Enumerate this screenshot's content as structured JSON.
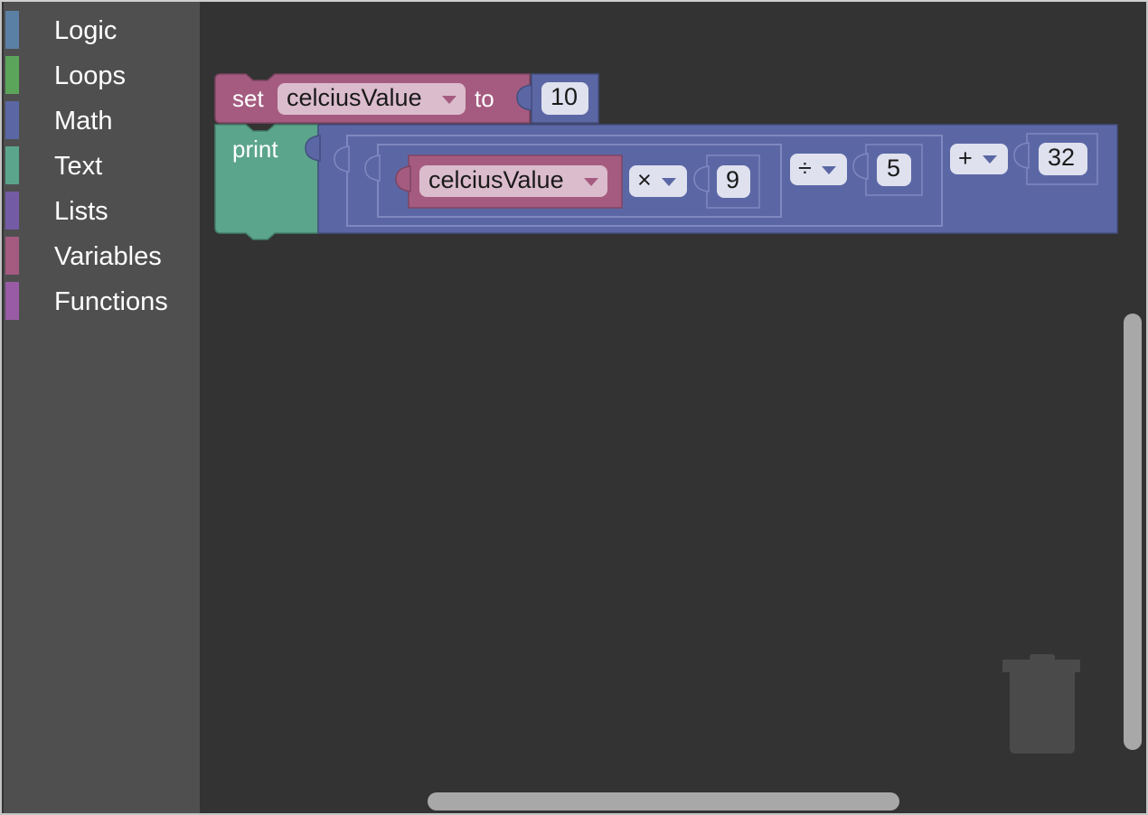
{
  "toolbox": {
    "categories": [
      {
        "label": "Logic",
        "color": "#5b80a5"
      },
      {
        "label": "Loops",
        "color": "#5ba55b"
      },
      {
        "label": "Math",
        "color": "#5b67a5"
      },
      {
        "label": "Text",
        "color": "#5ba58c"
      },
      {
        "label": "Lists",
        "color": "#745ba5"
      },
      {
        "label": "Variables",
        "color": "#a55b80"
      },
      {
        "label": "Functions",
        "color": "#995ba5"
      }
    ]
  },
  "workspace": {
    "set_block": {
      "keyword_set": "set",
      "variable": "celciusValue",
      "keyword_to": "to",
      "value": "10"
    },
    "print_block": {
      "keyword": "print",
      "variable": "celciusValue",
      "op_multiply": "×",
      "multiply_value": "9",
      "op_divide": "÷",
      "divide_value": "5",
      "op_add": "+",
      "add_value": "32"
    }
  },
  "icons": {
    "trash": "trash-icon",
    "dropdown": "chevron-down-icon"
  },
  "colors": {
    "workspace_bg": "#333333",
    "toolbox_bg": "#4f4f4f",
    "variables": "#a55b80",
    "math": "#5b67a5",
    "text": "#5ba58c"
  }
}
